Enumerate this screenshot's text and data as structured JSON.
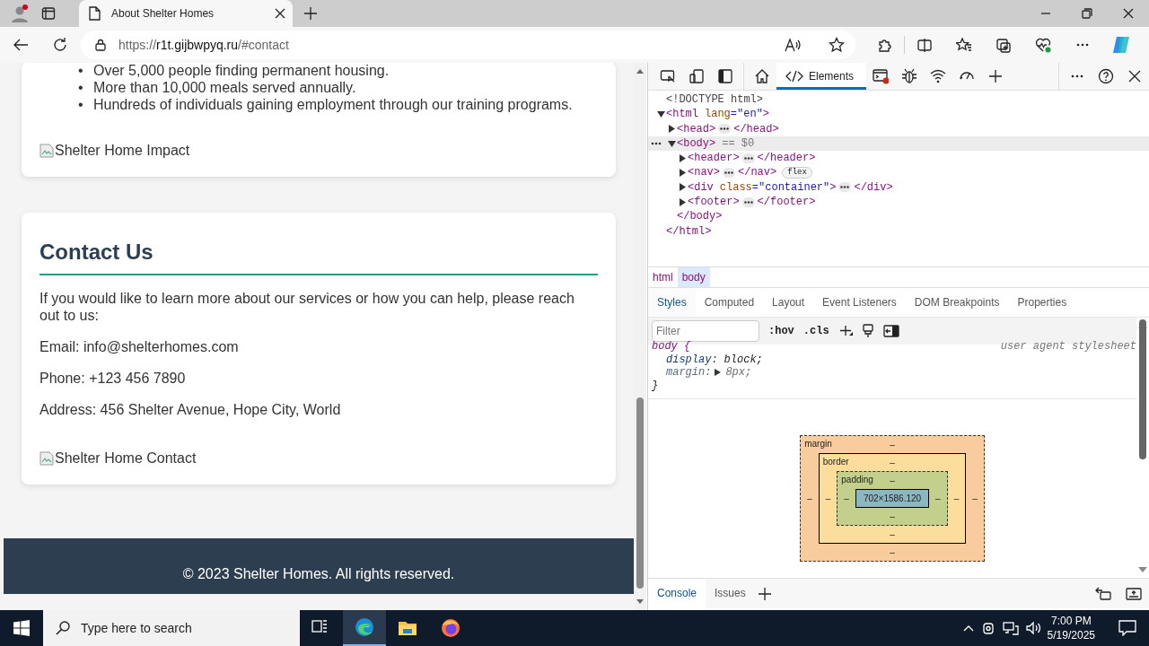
{
  "browser": {
    "tabs": [
      {
        "title": "About Shelter Homes",
        "selected": true
      }
    ],
    "url": {
      "scheme": "https://",
      "host": "r1t.gijbwpyq.ru",
      "path": "/#contact"
    }
  },
  "page": {
    "impact_list": [
      {
        "marker": "•",
        "text": "Over 5,000 people finding permanent housing."
      },
      {
        "marker": "•",
        "text": "More than 10,000 meals served annually."
      },
      {
        "marker": "•",
        "text": "Hundreds of individuals gaining employment through our training programs."
      }
    ],
    "impact_image_alt": "Shelter Home Impact",
    "contact": {
      "heading": "Contact Us",
      "intro": "If you would like to learn more about our services or how you can help, please reach out to us:",
      "details": [
        "Email: info@shelterhomes.com",
        "Phone: +123 456 7890",
        "Address: 456 Shelter Avenue, Hope City, World"
      ],
      "image_alt": "Shelter Home Contact"
    },
    "footer": "© 2023 Shelter Homes. All rights reserved."
  },
  "devtools": {
    "tabs": [
      {
        "label": "Elements",
        "selected": true
      }
    ],
    "dom_tree": [
      {
        "start": [
          {
            "text": "<!DOCTYPE html>",
            "kind": "plain"
          }
        ],
        "selected": false
      },
      {
        "start": [
          {
            "text": "<html",
            "kind": "tag"
          },
          {
            "text": "lang",
            "kind": "attr"
          },
          {
            "text": "=\"en\"",
            "kind": "value"
          },
          {
            "text": ">",
            "kind": "tag"
          }
        ],
        "expanded": true,
        "selected": false,
        "end": "</html>",
        "children": [
          {
            "start": [
              {
                "text": "<head>",
                "kind": "tag"
              }
            ],
            "expanded": false,
            "selected": false,
            "end": "</head>"
          },
          {
            "start": [
              {
                "text": "<body>",
                "kind": "tag"
              }
            ],
            "suffix": "== $0",
            "expanded": true,
            "selected": true,
            "end": "</body>",
            "children": [
              {
                "start": [
                  {
                    "text": "<header>",
                    "kind": "tag"
                  }
                ],
                "expanded": false,
                "selected": false,
                "end": "</header>"
              },
              {
                "start": [
                  {
                    "text": "<nav>",
                    "kind": "tag"
                  }
                ],
                "expanded": false,
                "selected": false,
                "end": "</nav>",
                "badge": "flex"
              },
              {
                "start": [
                  {
                    "text": "<div",
                    "kind": "tag"
                  },
                  {
                    "text": "class",
                    "kind": "attr"
                  },
                  {
                    "text": "=\"container\"",
                    "kind": "value"
                  },
                  {
                    "text": ">",
                    "kind": "tag"
                  }
                ],
                "expanded": false,
                "selected": false,
                "end": "</div>"
              },
              {
                "start": [
                  {
                    "text": "<footer>",
                    "kind": "tag"
                  }
                ],
                "expanded": false,
                "selected": false,
                "end": "</footer>"
              }
            ]
          }
        ]
      }
    ],
    "breadcrumbs": [
      {
        "label": "html",
        "selected": false
      },
      {
        "label": "body",
        "selected": true
      }
    ],
    "panel_tabs": [
      {
        "label": "Styles",
        "selected": true
      },
      {
        "label": "Computed",
        "selected": false
      },
      {
        "label": "Layout",
        "selected": false
      },
      {
        "label": "Event Listeners",
        "selected": false
      },
      {
        "label": "DOM Breakpoints",
        "selected": false
      },
      {
        "label": "Properties",
        "selected": false
      }
    ],
    "filter": {
      "placeholder": "Filter"
    },
    "toggles": [
      ":hov",
      ".cls"
    ],
    "rule": {
      "selector": "body {",
      "source": "user agent stylesheet",
      "declarations": [
        {
          "property": "display:",
          "value": "block;",
          "overridden": false
        },
        {
          "property": "margin:",
          "value": "8px;",
          "overridden": true
        }
      ],
      "close": "}"
    },
    "box_model": {
      "margin": {
        "label": "margin",
        "top": "–",
        "right": "–",
        "bottom": "–",
        "left": "–"
      },
      "border": {
        "label": "border",
        "top": "–",
        "right": "–",
        "bottom": "–",
        "left": "–"
      },
      "padding": {
        "label": "padding",
        "top": "–",
        "right": "–",
        "bottom": "–",
        "left": "–"
      },
      "content": "702×1586.120"
    },
    "drawer_tabs": [
      {
        "label": "Console",
        "selected": true
      },
      {
        "label": "Issues",
        "selected": false
      }
    ]
  },
  "taskbar": {
    "search_placeholder": "Type here to search",
    "apps": [
      {
        "kind": "task-view",
        "active": false
      },
      {
        "kind": "edge",
        "active": true
      },
      {
        "kind": "files",
        "active": false
      },
      {
        "kind": "firefox",
        "active": false
      }
    ],
    "time": "7:00 PM",
    "date": "5/19/2025"
  }
}
